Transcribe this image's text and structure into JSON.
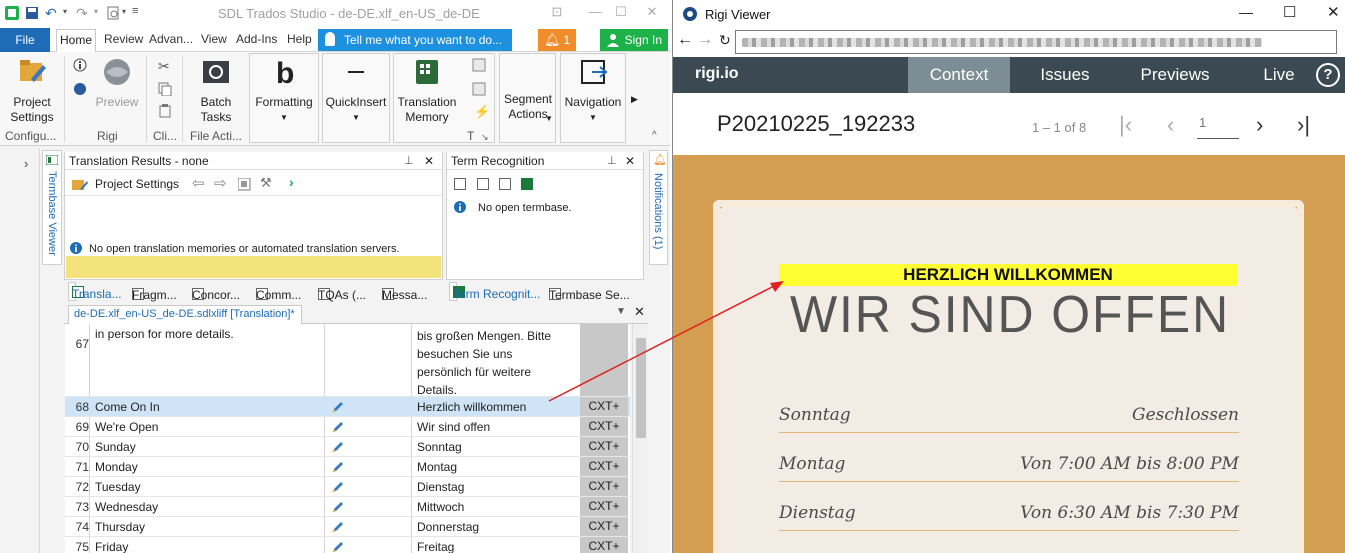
{
  "trados": {
    "title": "SDL Trados Studio - de-DE.xlf_en-US_de-DE",
    "ribbon_tabs": [
      "File",
      "Home",
      "Review",
      "Advan...",
      "View",
      "Add-Ins",
      "Help"
    ],
    "tell_me": "Tell me what you want to do...",
    "notifications_count": "1",
    "sign_in": "Sign In",
    "ribbon": {
      "project_settings": "Project\nSettings",
      "configu": "Configu...",
      "preview": "Preview",
      "rigi": "Rigi",
      "cli": "Cli...",
      "batch_tasks": "Batch\nTasks",
      "file_acti": "File Acti...",
      "formatting": "Formatting",
      "quickinsert": "QuickInsert",
      "translation_memory": "Translation\nMemory",
      "t_label": "T",
      "segment_actions": "Segment\nActions",
      "navigation": "Navigation"
    },
    "termbase_viewer": "Termbase Viewer",
    "notifications_side": "Notifications (1)",
    "translation_results": {
      "title": "Translation Results - none",
      "project_settings": "Project Settings",
      "message": "No open translation memories or automated translation servers."
    },
    "term_recognition": {
      "title": "Term Recognition",
      "message": "No open termbase."
    },
    "bottom_tabs_left": [
      "Transla...",
      "Fragm...",
      "Concor...",
      "Comm...",
      "TQAs (...",
      "Messa..."
    ],
    "bottom_tabs_right": [
      "Term Recognit...",
      "Termbase Se..."
    ],
    "doc_tab": "de-DE.xlf_en-US_de-DE.sdlxliff [Translation]*",
    "segments": [
      {
        "num": "67",
        "source": "in person for more details.",
        "target": "bis großen Mengen. Bitte\nbesuchen Sie uns\npersönlich für weitere\nDetails.",
        "status": ""
      },
      {
        "num": "68",
        "source": "Come On In",
        "target": "Herzlich willkommen",
        "status": "CXT+"
      },
      {
        "num": "69",
        "source": "We're Open",
        "target": "Wir sind offen",
        "status": "CXT+"
      },
      {
        "num": "70",
        "source": "Sunday",
        "target": "Sonntag",
        "status": "CXT+"
      },
      {
        "num": "71",
        "source": "Monday",
        "target": "Montag",
        "status": "CXT+"
      },
      {
        "num": "72",
        "source": "Tuesday",
        "target": "Dienstag",
        "status": "CXT+"
      },
      {
        "num": "73",
        "source": "Wednesday",
        "target": "Mittwoch",
        "status": "CXT+"
      },
      {
        "num": "74",
        "source": "Thursday",
        "target": "Donnerstag",
        "status": "CXT+"
      },
      {
        "num": "75",
        "source": "Friday",
        "target": "Freitag",
        "status": "CXT+"
      }
    ]
  },
  "rigi": {
    "title": "Rigi Viewer",
    "logo": "rigi.io",
    "nav": [
      "Context",
      "Issues",
      "Previews",
      "Live"
    ],
    "help": "?",
    "preview_name": "P20210225_192233",
    "pager": "1 – 1 of 8",
    "page_input": "1",
    "content": {
      "welcome": "HERZLICH WILLKOMMEN",
      "headline": "WIR SIND OFFEN",
      "hours": [
        {
          "day": "Sonntag",
          "time": "Geschlossen"
        },
        {
          "day": "Montag",
          "time": "Von 7:00 AM bis 8:00 PM"
        },
        {
          "day": "Dienstag",
          "time": "Von 6:30 AM bis 7:30 PM"
        }
      ]
    }
  },
  "colors": {
    "trados_blue": "#1e6bb8",
    "tell_me_blue": "#1e90e0",
    "notification_orange": "#f08c2a",
    "signin_green": "#1db14a",
    "rigi_nav": "#3b4a52",
    "rigi_active_tab": "#7d8d95",
    "preview_bg": "#d39e52",
    "welcome_highlight": "#ffff33",
    "arrow_red": "#e02020"
  }
}
